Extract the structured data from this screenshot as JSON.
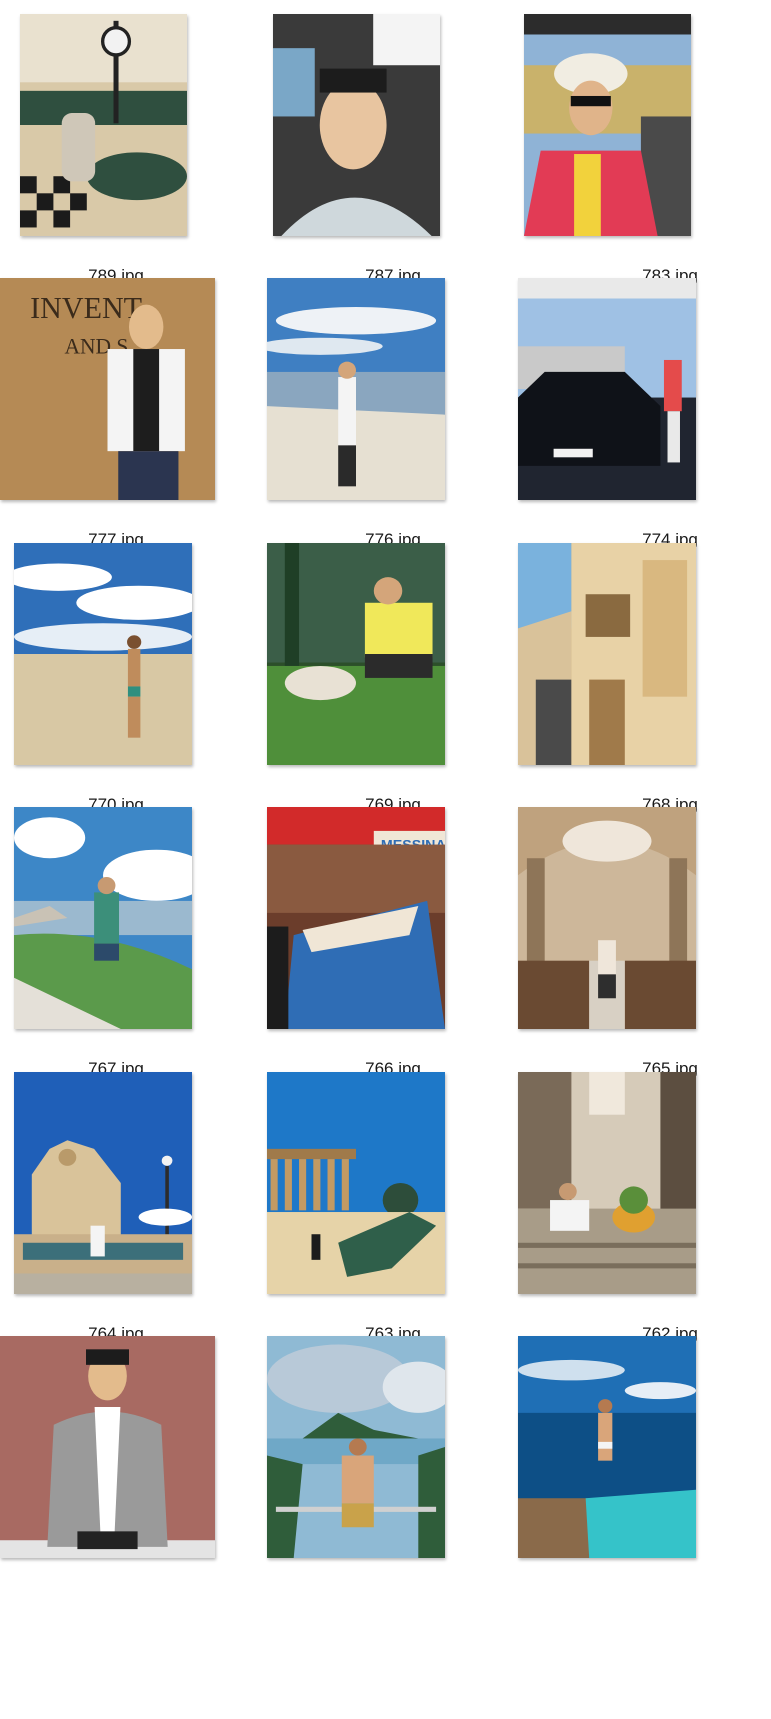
{
  "files": [
    {
      "name": "789.jpg",
      "scene": "hotel-lobby-clock-icon",
      "colors": [
        "#d9c9a8",
        "#2f4f3f",
        "#f2f2f2",
        "#1b1b1b"
      ]
    },
    {
      "name": "787.jpg",
      "scene": "car-selfie-icon",
      "colors": [
        "#cfd8dc",
        "#3a3a3a",
        "#7aa7c7",
        "#e8c5a0"
      ]
    },
    {
      "name": "783.jpg",
      "scene": "convertible-hat-icon",
      "colors": [
        "#8fb3d6",
        "#c9b26b",
        "#e23b55",
        "#f2d23c"
      ]
    },
    {
      "name": "777.jpg",
      "scene": "suit-bowtie-icon",
      "colors": [
        "#b58a55",
        "#1d1d1d",
        "#f4f4f4",
        "#2b3550"
      ]
    },
    {
      "name": "776.jpg",
      "scene": "seaside-bay-icon",
      "colors": [
        "#3f7fc2",
        "#eef2f6",
        "#8aa6bf",
        "#2a2a2a"
      ]
    },
    {
      "name": "774.jpg",
      "scene": "black-car-icon",
      "colors": [
        "#9fc1e4",
        "#0f1218",
        "#c9c9c9",
        "#e44b4b"
      ]
    },
    {
      "name": "770.jpg",
      "scene": "beach-icon",
      "colors": [
        "#2f6fb9",
        "#ffffff",
        "#d8c8a4",
        "#bf8c5c"
      ]
    },
    {
      "name": "769.jpg",
      "scene": "dog-grass-icon",
      "colors": [
        "#4f8f3a",
        "#f0e85a",
        "#e8e1d4",
        "#2c4f2a"
      ]
    },
    {
      "name": "768.jpg",
      "scene": "old-street-icon",
      "colors": [
        "#7ab2dd",
        "#c9a66b",
        "#e8d2a6",
        "#4a4a4a"
      ]
    },
    {
      "name": "767.jpg",
      "scene": "hill-view-icon",
      "colors": [
        "#3d87c7",
        "#ffffff",
        "#5b9a4b",
        "#c9c2b5"
      ]
    },
    {
      "name": "766.jpg",
      "scene": "market-stall-icon",
      "colors": [
        "#d22a2a",
        "#2f6db5",
        "#f0e6d6",
        "#6b3d2b"
      ]
    },
    {
      "name": "765.jpg",
      "scene": "cathedral-icon",
      "colors": [
        "#cdb79a",
        "#6a4a32",
        "#efe6da",
        "#2e2e2e"
      ]
    },
    {
      "name": "764.jpg",
      "scene": "baroque-church-icon",
      "colors": [
        "#1f5fb8",
        "#d9c39a",
        "#ffffff",
        "#3c6f7a"
      ]
    },
    {
      "name": "763.jpg",
      "scene": "greek-temple-icon",
      "colors": [
        "#1e78c8",
        "#c39a63",
        "#2d4d3a",
        "#e6d3a8"
      ]
    },
    {
      "name": "762.jpg",
      "scene": "alley-steps-icon",
      "colors": [
        "#d6cbb9",
        "#7a6a58",
        "#5a8f3a",
        "#e0a030"
      ]
    },
    {
      "name": "",
      "scene": "grey-suit-icon",
      "colors": [
        "#a86a62",
        "#9a9a9a",
        "#ffffff",
        "#222222"
      ]
    },
    {
      "name": "",
      "scene": "tropical-island-icon",
      "colors": [
        "#b8c9d8",
        "#2f5d3a",
        "#8fbad4",
        "#c9a24a"
      ]
    },
    {
      "name": "",
      "scene": "infinity-pool-icon",
      "colors": [
        "#1f6fb5",
        "#0d4f86",
        "#35c3c9",
        "#8a6a4a"
      ]
    }
  ]
}
